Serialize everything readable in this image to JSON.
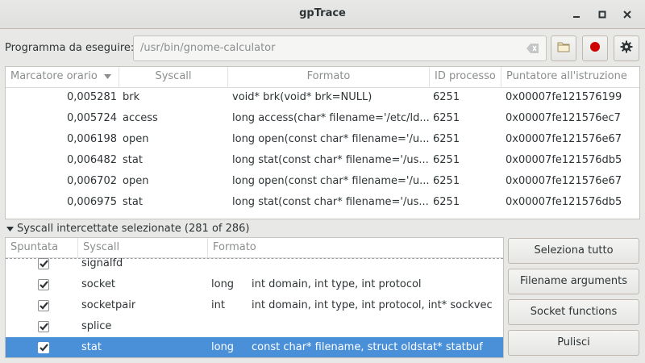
{
  "window": {
    "title": "gpTrace",
    "controls": [
      "minimize-icon",
      "maximize-icon",
      "close-icon"
    ]
  },
  "toolbar": {
    "program_label": "Programma da eseguire:",
    "program_value": "/usr/bin/gnome-calculator",
    "icons": [
      "clear-icon",
      "folder-icon",
      "record-icon",
      "gear-icon"
    ],
    "record_color": "#cc0000"
  },
  "trace_table": {
    "columns": [
      "Marcatore orario",
      "Syscall",
      "Formato",
      "ID processo",
      "Puntatore all'istruzione"
    ],
    "sort_indicator": "chevron-down-icon",
    "rows": [
      {
        "time": "0,005281",
        "syscall": "brk",
        "format": "void* brk(void* brk=NULL)",
        "pid": "6251",
        "ip": "0x00007fe121576199"
      },
      {
        "time": "0,005724",
        "syscall": "access",
        "format": "long access(char* filename='/etc/ld...",
        "pid": "6251",
        "ip": "0x00007fe121576ec7"
      },
      {
        "time": "0,006198",
        "syscall": "open",
        "format": "long open(const char* filename='/u...",
        "pid": "6251",
        "ip": "0x00007fe121576e67"
      },
      {
        "time": "0,006482",
        "syscall": "stat",
        "format": "long stat(const char* filename='/us...",
        "pid": "6251",
        "ip": "0x00007fe121576db5"
      },
      {
        "time": "0,006702",
        "syscall": "open",
        "format": "long open(const char* filename='/u...",
        "pid": "6251",
        "ip": "0x00007fe121576e67"
      },
      {
        "time": "0,006975",
        "syscall": "stat",
        "format": "long stat(const char* filename='/us...",
        "pid": "6251",
        "ip": "0x00007fe121576db5"
      }
    ]
  },
  "expander": {
    "label": "Syscall intercettate selezionate (281 of 286)"
  },
  "syscall_table": {
    "columns": [
      "Spuntata",
      "Syscall",
      "Formato"
    ],
    "rows": [
      {
        "checked": true,
        "name": "signalfd",
        "ret": "",
        "args": "",
        "selected": false
      },
      {
        "checked": true,
        "name": "socket",
        "ret": "long",
        "args": "int domain, int type, int protocol",
        "selected": false
      },
      {
        "checked": true,
        "name": "socketpair",
        "ret": "int",
        "args": "int domain, int type, int protocol, int* sockvec",
        "selected": false
      },
      {
        "checked": true,
        "name": "splice",
        "ret": "",
        "args": "",
        "selected": false
      },
      {
        "checked": true,
        "name": "stat",
        "ret": "long",
        "args": "const char* filename, struct oldstat* statbuf",
        "selected": true
      }
    ],
    "selection_color": "#4a90d9"
  },
  "side_buttons": {
    "select_all": "Seleziona tutto",
    "filename_arguments": "Filename arguments",
    "socket_functions": "Socket functions",
    "clear": "Pulisci"
  }
}
